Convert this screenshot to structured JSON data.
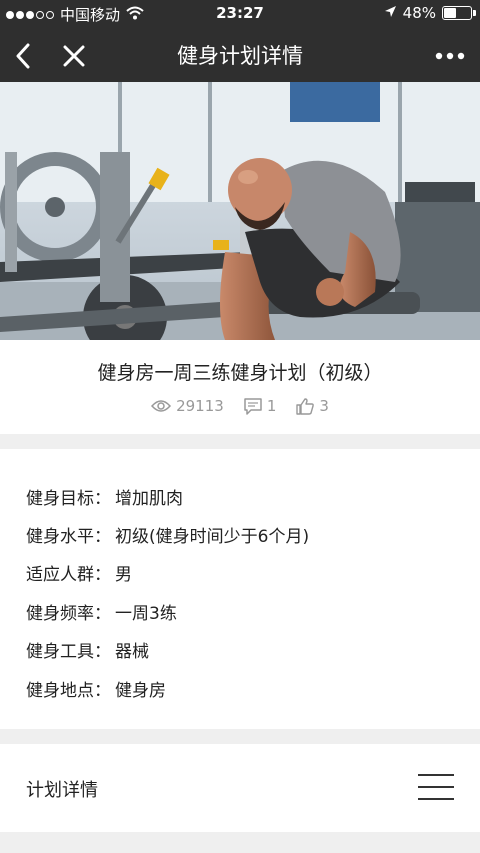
{
  "status_bar": {
    "carrier": "中国移动",
    "time": "23:27",
    "battery": "48%",
    "battery_level": 0.48,
    "signal_bars_filled": 3,
    "signal_bars_total": 5
  },
  "nav": {
    "title": "健身计划详情",
    "back_icon": "chevron-left-icon",
    "close_icon": "close-icon",
    "more_icon": "more-dots-icon"
  },
  "plan": {
    "title": "健身房一周三练健身计划（初级）",
    "views": "29113",
    "comments": "1",
    "likes": "3"
  },
  "info": {
    "rows": [
      {
        "label": "健身目标：",
        "value": "增加肌肉"
      },
      {
        "label": "健身水平：",
        "value": "初级(健身时间少于6个月)"
      },
      {
        "label": "适应人群：",
        "value": "男"
      },
      {
        "label": "健身频率：",
        "value": "一周3练"
      },
      {
        "label": "健身工具：",
        "value": "器械"
      },
      {
        "label": "健身地点：",
        "value": "健身房"
      }
    ]
  },
  "detail": {
    "label": "计划详情",
    "menu_icon": "menu-icon"
  },
  "colors": {
    "nav_bg": "#2f2f2f",
    "page_bg": "#efefef",
    "stat_gray": "#999999"
  }
}
